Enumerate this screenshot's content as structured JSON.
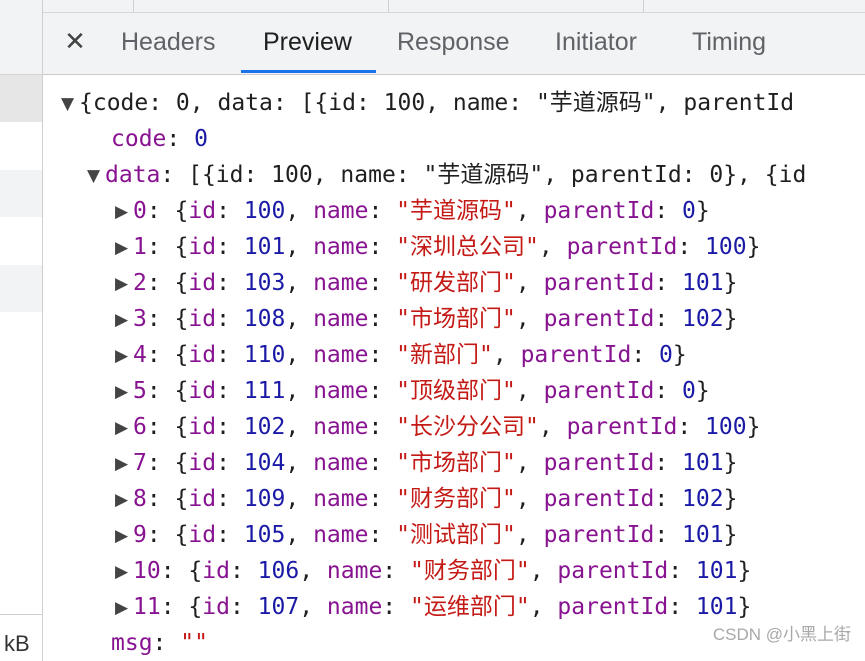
{
  "window": {
    "size_label": "kB"
  },
  "tabs": [
    {
      "label": "Headers",
      "active": false
    },
    {
      "label": "Preview",
      "active": true
    },
    {
      "label": "Response",
      "active": false
    },
    {
      "label": "Initiator",
      "active": false
    },
    {
      "label": "Timing",
      "active": false
    }
  ],
  "close_glyph": "✕",
  "preview": {
    "summary": "{code: 0, data: [{id: 100, name: \"芋道源码\", parentId",
    "code_key": "code",
    "code_value": "0",
    "data_key": "data",
    "data_summary": "[{id: 100, name: \"芋道源码\", parentId: 0}, {id",
    "items": [
      {
        "index": "0",
        "id": "100",
        "name": "\"芋道源码\"",
        "parentId": "0"
      },
      {
        "index": "1",
        "id": "101",
        "name": "\"深圳总公司\"",
        "parentId": "100"
      },
      {
        "index": "2",
        "id": "103",
        "name": "\"研发部门\"",
        "parentId": "101"
      },
      {
        "index": "3",
        "id": "108",
        "name": "\"市场部门\"",
        "parentId": "102"
      },
      {
        "index": "4",
        "id": "110",
        "name": "\"新部门\"",
        "parentId": "0"
      },
      {
        "index": "5",
        "id": "111",
        "name": "\"顶级部门\"",
        "parentId": "0"
      },
      {
        "index": "6",
        "id": "102",
        "name": "\"长沙分公司\"",
        "parentId": "100"
      },
      {
        "index": "7",
        "id": "104",
        "name": "\"市场部门\"",
        "parentId": "101"
      },
      {
        "index": "8",
        "id": "109",
        "name": "\"财务部门\"",
        "parentId": "102"
      },
      {
        "index": "9",
        "id": "105",
        "name": "\"测试部门\"",
        "parentId": "101"
      },
      {
        "index": "10",
        "id": "106",
        "name": "\"财务部门\"",
        "parentId": "101"
      },
      {
        "index": "11",
        "id": "107",
        "name": "\"运维部门\"",
        "parentId": "101"
      }
    ],
    "msg_key": "msg",
    "msg_value": "\"\""
  },
  "watermark": "CSDN @小黑上街",
  "colors": {
    "key": "#881391",
    "number": "#1a1aa6",
    "string": "#c41a16",
    "active_tab_underline": "#1a73e8"
  }
}
